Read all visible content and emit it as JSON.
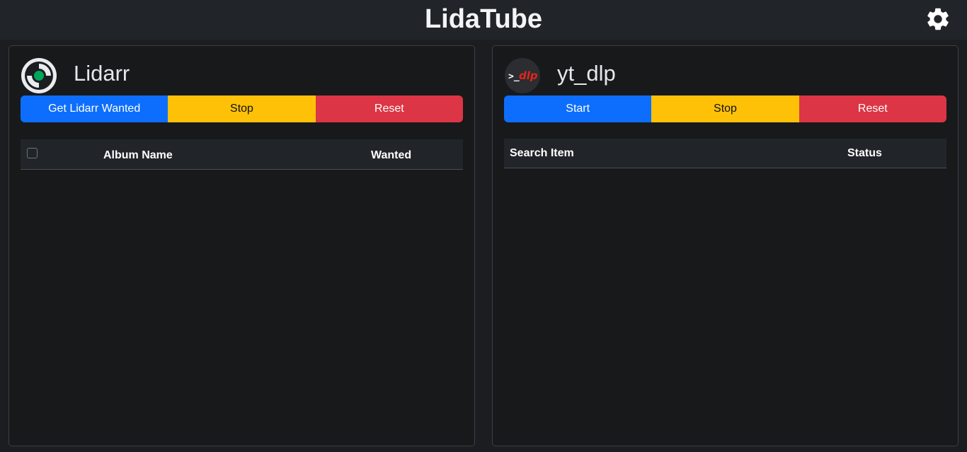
{
  "header": {
    "title": "LidaTube",
    "settings_icon": "gear-icon"
  },
  "lidarr": {
    "title": "Lidarr",
    "logo_icon": "lidarr-logo-icon",
    "buttons": {
      "get_wanted": "Get Lidarr Wanted",
      "stop": "Stop",
      "reset": "Reset"
    },
    "table": {
      "columns": [
        "Album Name",
        "Wanted"
      ],
      "rows": []
    }
  },
  "ytdlp": {
    "title": "yt_dlp",
    "logo_icon": "ytdlp-logo-icon",
    "logo_prompt": ">_",
    "logo_text": "dlp",
    "buttons": {
      "start": "Start",
      "stop": "Stop",
      "reset": "Reset"
    },
    "table": {
      "columns": [
        "Search Item",
        "Status"
      ],
      "rows": []
    }
  },
  "colors": {
    "primary": "#0d6efd",
    "warning": "#ffc107",
    "danger": "#dc3545",
    "background": "#1b1d20",
    "panel": "#18191b"
  }
}
